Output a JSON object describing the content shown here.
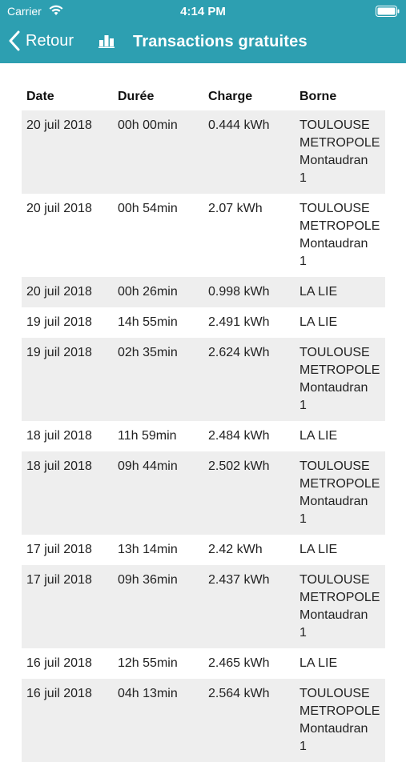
{
  "status": {
    "carrier": "Carrier",
    "time": "4:14 PM"
  },
  "nav": {
    "back_label": "Retour",
    "title": "Transactions gratuites",
    "chart_icon": "bar-chart-icon"
  },
  "colors": {
    "header_bg": "#2d9fb1",
    "row_alt_bg": "#eeeeee"
  },
  "table": {
    "headers": [
      "Date",
      "Durée",
      "Charge",
      "Borne"
    ],
    "rows": [
      {
        "date": "20 juil 2018",
        "duree": "00h 00min",
        "charge": "0.444 kWh",
        "borne": [
          "TOULOUSE",
          "METROPOLE",
          "Montaudran",
          "1"
        ]
      },
      {
        "date": "20 juil 2018",
        "duree": "00h 54min",
        "charge": "2.07 kWh",
        "borne": [
          "TOULOUSE",
          "METROPOLE",
          "Montaudran",
          "1"
        ]
      },
      {
        "date": "20 juil 2018",
        "duree": "00h 26min",
        "charge": "0.998 kWh",
        "borne": [
          "LA LIE"
        ]
      },
      {
        "date": "19 juil 2018",
        "duree": "14h 55min",
        "charge": "2.491 kWh",
        "borne": [
          "LA LIE"
        ]
      },
      {
        "date": "19 juil 2018",
        "duree": "02h 35min",
        "charge": "2.624 kWh",
        "borne": [
          "TOULOUSE",
          "METROPOLE",
          "Montaudran",
          "1"
        ]
      },
      {
        "date": "18 juil 2018",
        "duree": "11h 59min",
        "charge": "2.484 kWh",
        "borne": [
          "LA LIE"
        ]
      },
      {
        "date": "18 juil 2018",
        "duree": "09h 44min",
        "charge": "2.502 kWh",
        "borne": [
          "TOULOUSE",
          "METROPOLE",
          "Montaudran",
          "1"
        ]
      },
      {
        "date": "17 juil 2018",
        "duree": "13h 14min",
        "charge": "2.42 kWh",
        "borne": [
          "LA LIE"
        ]
      },
      {
        "date": "17 juil 2018",
        "duree": "09h 36min",
        "charge": "2.437 kWh",
        "borne": [
          "TOULOUSE",
          "METROPOLE",
          "Montaudran",
          "1"
        ]
      },
      {
        "date": "16 juil 2018",
        "duree": "12h 55min",
        "charge": "2.465 kWh",
        "borne": [
          "LA LIE"
        ]
      },
      {
        "date": "16 juil 2018",
        "duree": "04h 13min",
        "charge": "2.564 kWh",
        "borne": [
          "TOULOUSE",
          "METROPOLE",
          "Montaudran",
          "1"
        ]
      }
    ]
  }
}
